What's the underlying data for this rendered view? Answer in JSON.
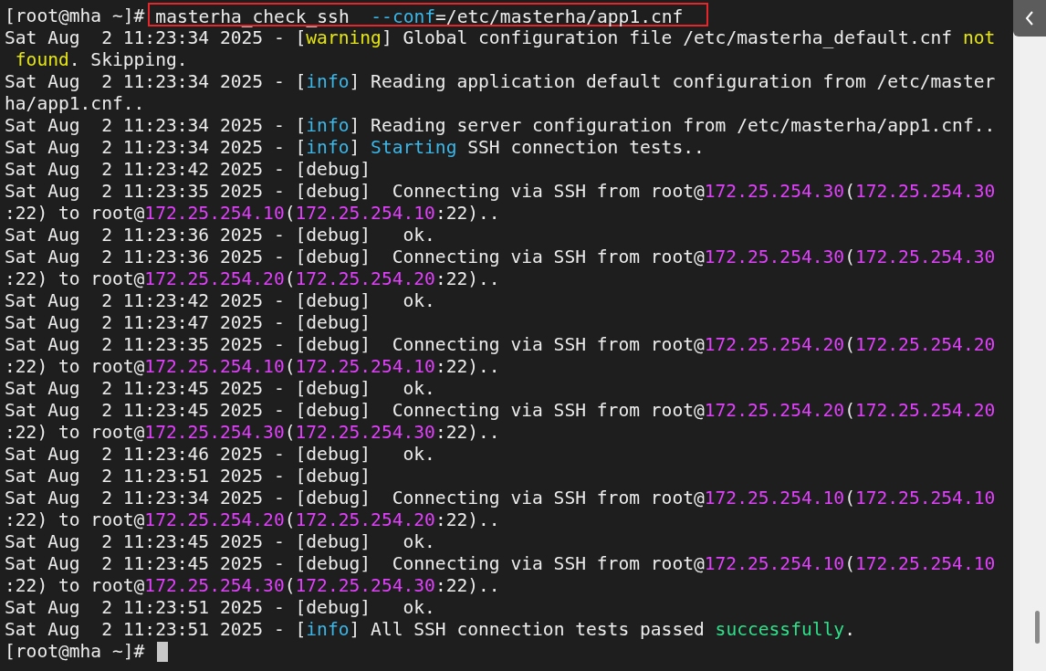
{
  "terminal": {
    "lines": [
      {
        "prompt": "[root@mha ~]#",
        "command_highlighted": true,
        "command": [
          {
            "text": "masterha_check_ssh  ",
            "kind": "plain"
          },
          {
            "text": "--conf",
            "kind": "info"
          },
          {
            "text": "=/etc/masterha/app1.cnf",
            "kind": "plain"
          }
        ]
      },
      {
        "segments": [
          {
            "text": "Sat Aug  2 11:23:34 2025 - [",
            "kind": "plain"
          },
          {
            "text": "warning",
            "kind": "warning"
          },
          {
            "text": "] Global configuration file /etc/masterha_default.cnf ",
            "kind": "plain"
          },
          {
            "text": "not",
            "kind": "warning"
          }
        ]
      },
      {
        "segments": [
          {
            "text": " found",
            "kind": "warning"
          },
          {
            "text": ". Skipping.",
            "kind": "plain"
          }
        ]
      },
      {
        "segments": [
          {
            "text": "Sat Aug  2 11:23:34 2025 - [",
            "kind": "plain"
          },
          {
            "text": "info",
            "kind": "info"
          },
          {
            "text": "] Reading application default configuration from /etc/master",
            "kind": "plain"
          }
        ]
      },
      {
        "segments": [
          {
            "text": "ha/app1.cnf..",
            "kind": "plain"
          }
        ]
      },
      {
        "segments": [
          {
            "text": "Sat Aug  2 11:23:34 2025 - [",
            "kind": "plain"
          },
          {
            "text": "info",
            "kind": "info"
          },
          {
            "text": "] Reading server configuration from /etc/masterha/app1.cnf..",
            "kind": "plain"
          }
        ]
      },
      {
        "segments": [
          {
            "text": "Sat Aug  2 11:23:34 2025 - [",
            "kind": "plain"
          },
          {
            "text": "info",
            "kind": "info"
          },
          {
            "text": "] ",
            "kind": "plain"
          },
          {
            "text": "Starting",
            "kind": "info"
          },
          {
            "text": " SSH connection tests..",
            "kind": "plain"
          }
        ]
      },
      {
        "segments": [
          {
            "text": "Sat Aug  2 11:23:42 2025 - [debug]",
            "kind": "plain"
          }
        ]
      },
      {
        "segments": [
          {
            "text": "Sat Aug  2 11:23:35 2025 - [debug]  Connecting via SSH from root@",
            "kind": "plain"
          },
          {
            "text": "172.25.254.30",
            "kind": "address"
          },
          {
            "text": "(",
            "kind": "plain"
          },
          {
            "text": "172.25.254.30",
            "kind": "address"
          }
        ]
      },
      {
        "segments": [
          {
            "text": ":22) to root@",
            "kind": "plain"
          },
          {
            "text": "172.25.254.10",
            "kind": "address"
          },
          {
            "text": "(",
            "kind": "plain"
          },
          {
            "text": "172.25.254.10",
            "kind": "address"
          },
          {
            "text": ":22)..",
            "kind": "plain"
          }
        ]
      },
      {
        "segments": [
          {
            "text": "Sat Aug  2 11:23:36 2025 - [debug]   ok.",
            "kind": "plain"
          }
        ]
      },
      {
        "segments": [
          {
            "text": "Sat Aug  2 11:23:36 2025 - [debug]  Connecting via SSH from root@",
            "kind": "plain"
          },
          {
            "text": "172.25.254.30",
            "kind": "address"
          },
          {
            "text": "(",
            "kind": "plain"
          },
          {
            "text": "172.25.254.30",
            "kind": "address"
          }
        ]
      },
      {
        "segments": [
          {
            "text": ":22) to root@",
            "kind": "plain"
          },
          {
            "text": "172.25.254.20",
            "kind": "address"
          },
          {
            "text": "(",
            "kind": "plain"
          },
          {
            "text": "172.25.254.20",
            "kind": "address"
          },
          {
            "text": ":22)..",
            "kind": "plain"
          }
        ]
      },
      {
        "segments": [
          {
            "text": "Sat Aug  2 11:23:42 2025 - [debug]   ok.",
            "kind": "plain"
          }
        ]
      },
      {
        "segments": [
          {
            "text": "Sat Aug  2 11:23:47 2025 - [debug]",
            "kind": "plain"
          }
        ]
      },
      {
        "segments": [
          {
            "text": "Sat Aug  2 11:23:35 2025 - [debug]  Connecting via SSH from root@",
            "kind": "plain"
          },
          {
            "text": "172.25.254.20",
            "kind": "address"
          },
          {
            "text": "(",
            "kind": "plain"
          },
          {
            "text": "172.25.254.20",
            "kind": "address"
          }
        ]
      },
      {
        "segments": [
          {
            "text": ":22) to root@",
            "kind": "plain"
          },
          {
            "text": "172.25.254.10",
            "kind": "address"
          },
          {
            "text": "(",
            "kind": "plain"
          },
          {
            "text": "172.25.254.10",
            "kind": "address"
          },
          {
            "text": ":22)..",
            "kind": "plain"
          }
        ]
      },
      {
        "segments": [
          {
            "text": "Sat Aug  2 11:23:45 2025 - [debug]   ok.",
            "kind": "plain"
          }
        ]
      },
      {
        "segments": [
          {
            "text": "Sat Aug  2 11:23:45 2025 - [debug]  Connecting via SSH from root@",
            "kind": "plain"
          },
          {
            "text": "172.25.254.20",
            "kind": "address"
          },
          {
            "text": "(",
            "kind": "plain"
          },
          {
            "text": "172.25.254.20",
            "kind": "address"
          }
        ]
      },
      {
        "segments": [
          {
            "text": ":22) to root@",
            "kind": "plain"
          },
          {
            "text": "172.25.254.30",
            "kind": "address"
          },
          {
            "text": "(",
            "kind": "plain"
          },
          {
            "text": "172.25.254.30",
            "kind": "address"
          },
          {
            "text": ":22)..",
            "kind": "plain"
          }
        ]
      },
      {
        "segments": [
          {
            "text": "Sat Aug  2 11:23:46 2025 - [debug]   ok.",
            "kind": "plain"
          }
        ]
      },
      {
        "segments": [
          {
            "text": "Sat Aug  2 11:23:51 2025 - [debug]",
            "kind": "plain"
          }
        ]
      },
      {
        "segments": [
          {
            "text": "Sat Aug  2 11:23:34 2025 - [debug]  Connecting via SSH from root@",
            "kind": "plain"
          },
          {
            "text": "172.25.254.10",
            "kind": "address"
          },
          {
            "text": "(",
            "kind": "plain"
          },
          {
            "text": "172.25.254.10",
            "kind": "address"
          }
        ]
      },
      {
        "segments": [
          {
            "text": ":22) to root@",
            "kind": "plain"
          },
          {
            "text": "172.25.254.20",
            "kind": "address"
          },
          {
            "text": "(",
            "kind": "plain"
          },
          {
            "text": "172.25.254.20",
            "kind": "address"
          },
          {
            "text": ":22)..",
            "kind": "plain"
          }
        ]
      },
      {
        "segments": [
          {
            "text": "Sat Aug  2 11:23:45 2025 - [debug]   ok.",
            "kind": "plain"
          }
        ]
      },
      {
        "segments": [
          {
            "text": "Sat Aug  2 11:23:45 2025 - [debug]  Connecting via SSH from root@",
            "kind": "plain"
          },
          {
            "text": "172.25.254.10",
            "kind": "address"
          },
          {
            "text": "(",
            "kind": "plain"
          },
          {
            "text": "172.25.254.10",
            "kind": "address"
          }
        ]
      },
      {
        "segments": [
          {
            "text": ":22) to root@",
            "kind": "plain"
          },
          {
            "text": "172.25.254.30",
            "kind": "address"
          },
          {
            "text": "(",
            "kind": "plain"
          },
          {
            "text": "172.25.254.30",
            "kind": "address"
          },
          {
            "text": ":22)..",
            "kind": "plain"
          }
        ]
      },
      {
        "segments": [
          {
            "text": "Sat Aug  2 11:23:51 2025 - [debug]   ok.",
            "kind": "plain"
          }
        ]
      },
      {
        "segments": [
          {
            "text": "Sat Aug  2 11:23:51 2025 - [",
            "kind": "plain"
          },
          {
            "text": "info",
            "kind": "info"
          },
          {
            "text": "] All SSH connection tests passed ",
            "kind": "plain"
          },
          {
            "text": "successfully",
            "kind": "success"
          },
          {
            "text": ".",
            "kind": "plain"
          }
        ]
      },
      {
        "prompt": "[root@mha ~]#",
        "cursor": true
      }
    ]
  }
}
